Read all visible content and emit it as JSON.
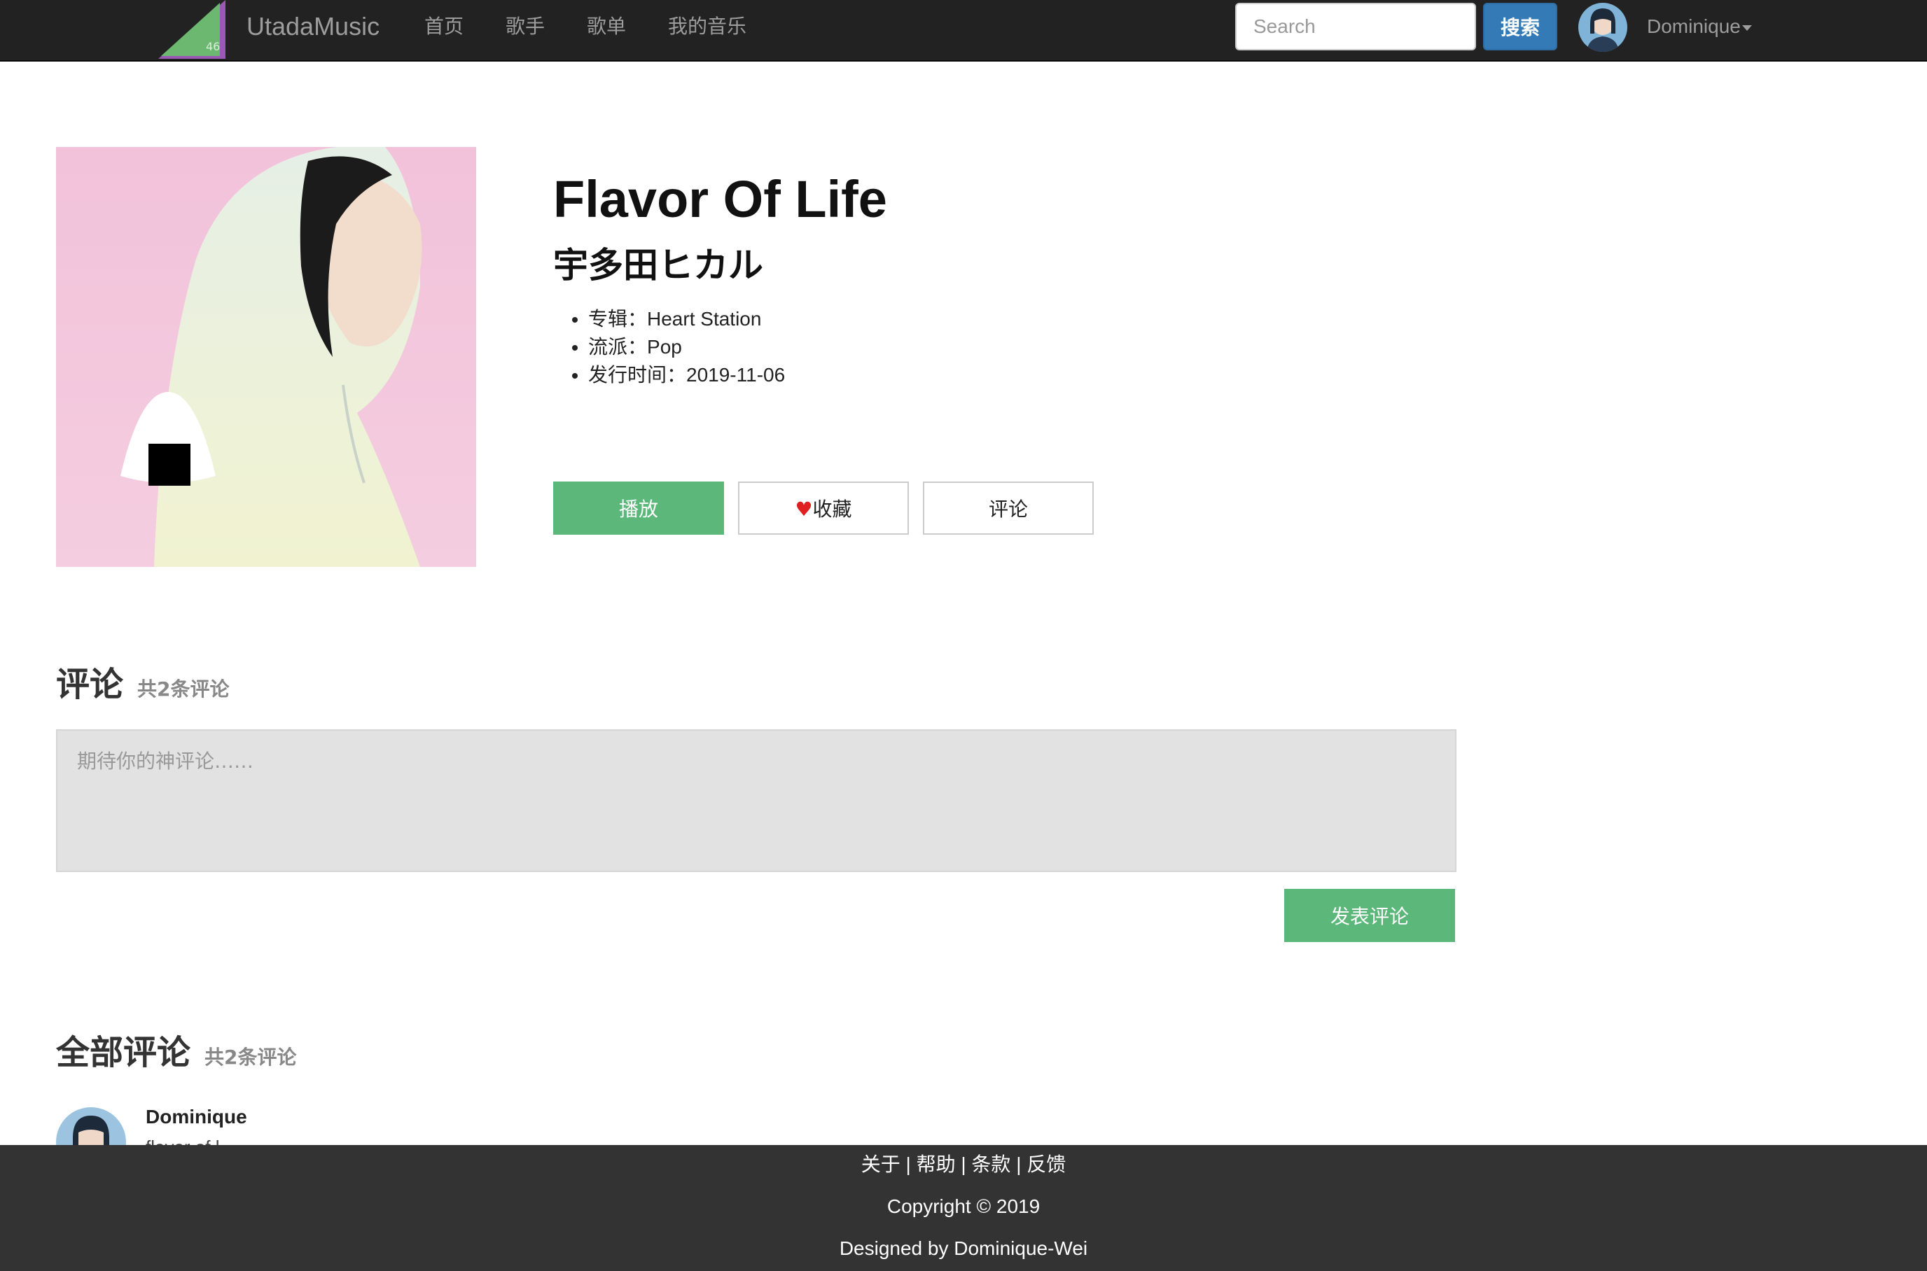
{
  "navbar": {
    "brand": "UtadaMusic",
    "logo_text": "46",
    "nav_items": [
      "首页",
      "歌手",
      "歌单",
      "我的音乐"
    ],
    "search_placeholder": "Search",
    "search_button": "搜索",
    "user_name": "Dominique"
  },
  "song": {
    "title": "Flavor Of Life",
    "artist": "宇多田ヒカル",
    "meta": [
      {
        "label": "专辑：",
        "value": "Heart Station"
      },
      {
        "label": "流派：",
        "value": "Pop"
      },
      {
        "label": "发行时间：",
        "value": "2019-11-06"
      }
    ],
    "buttons": {
      "play": "播放",
      "favorite_icon": "♥",
      "favorite": "收藏",
      "comment": "评论"
    }
  },
  "comment_form": {
    "heading": "评论",
    "count_text": "共2条评论",
    "placeholder": "期待你的神评论……",
    "submit": "发表评论"
  },
  "comment_list": {
    "heading": "全部评论",
    "count_text": "共2条评论",
    "items": [
      {
        "user": "Dominique",
        "text": "flavor of l"
      }
    ]
  },
  "footer": {
    "links": [
      "关于",
      "帮助",
      "条款",
      "反馈"
    ],
    "separator": " | ",
    "copyright": "Copyright © 2019",
    "designed_by": "Designed by Dominique-Wei"
  },
  "colors": {
    "navbar_bg": "#222222",
    "accent_green": "#5cb87a",
    "search_button_blue": "#337ab7",
    "comment_box_bg": "#e2e2e2",
    "footer_bg": "#333333",
    "heart_red": "#e02020"
  }
}
